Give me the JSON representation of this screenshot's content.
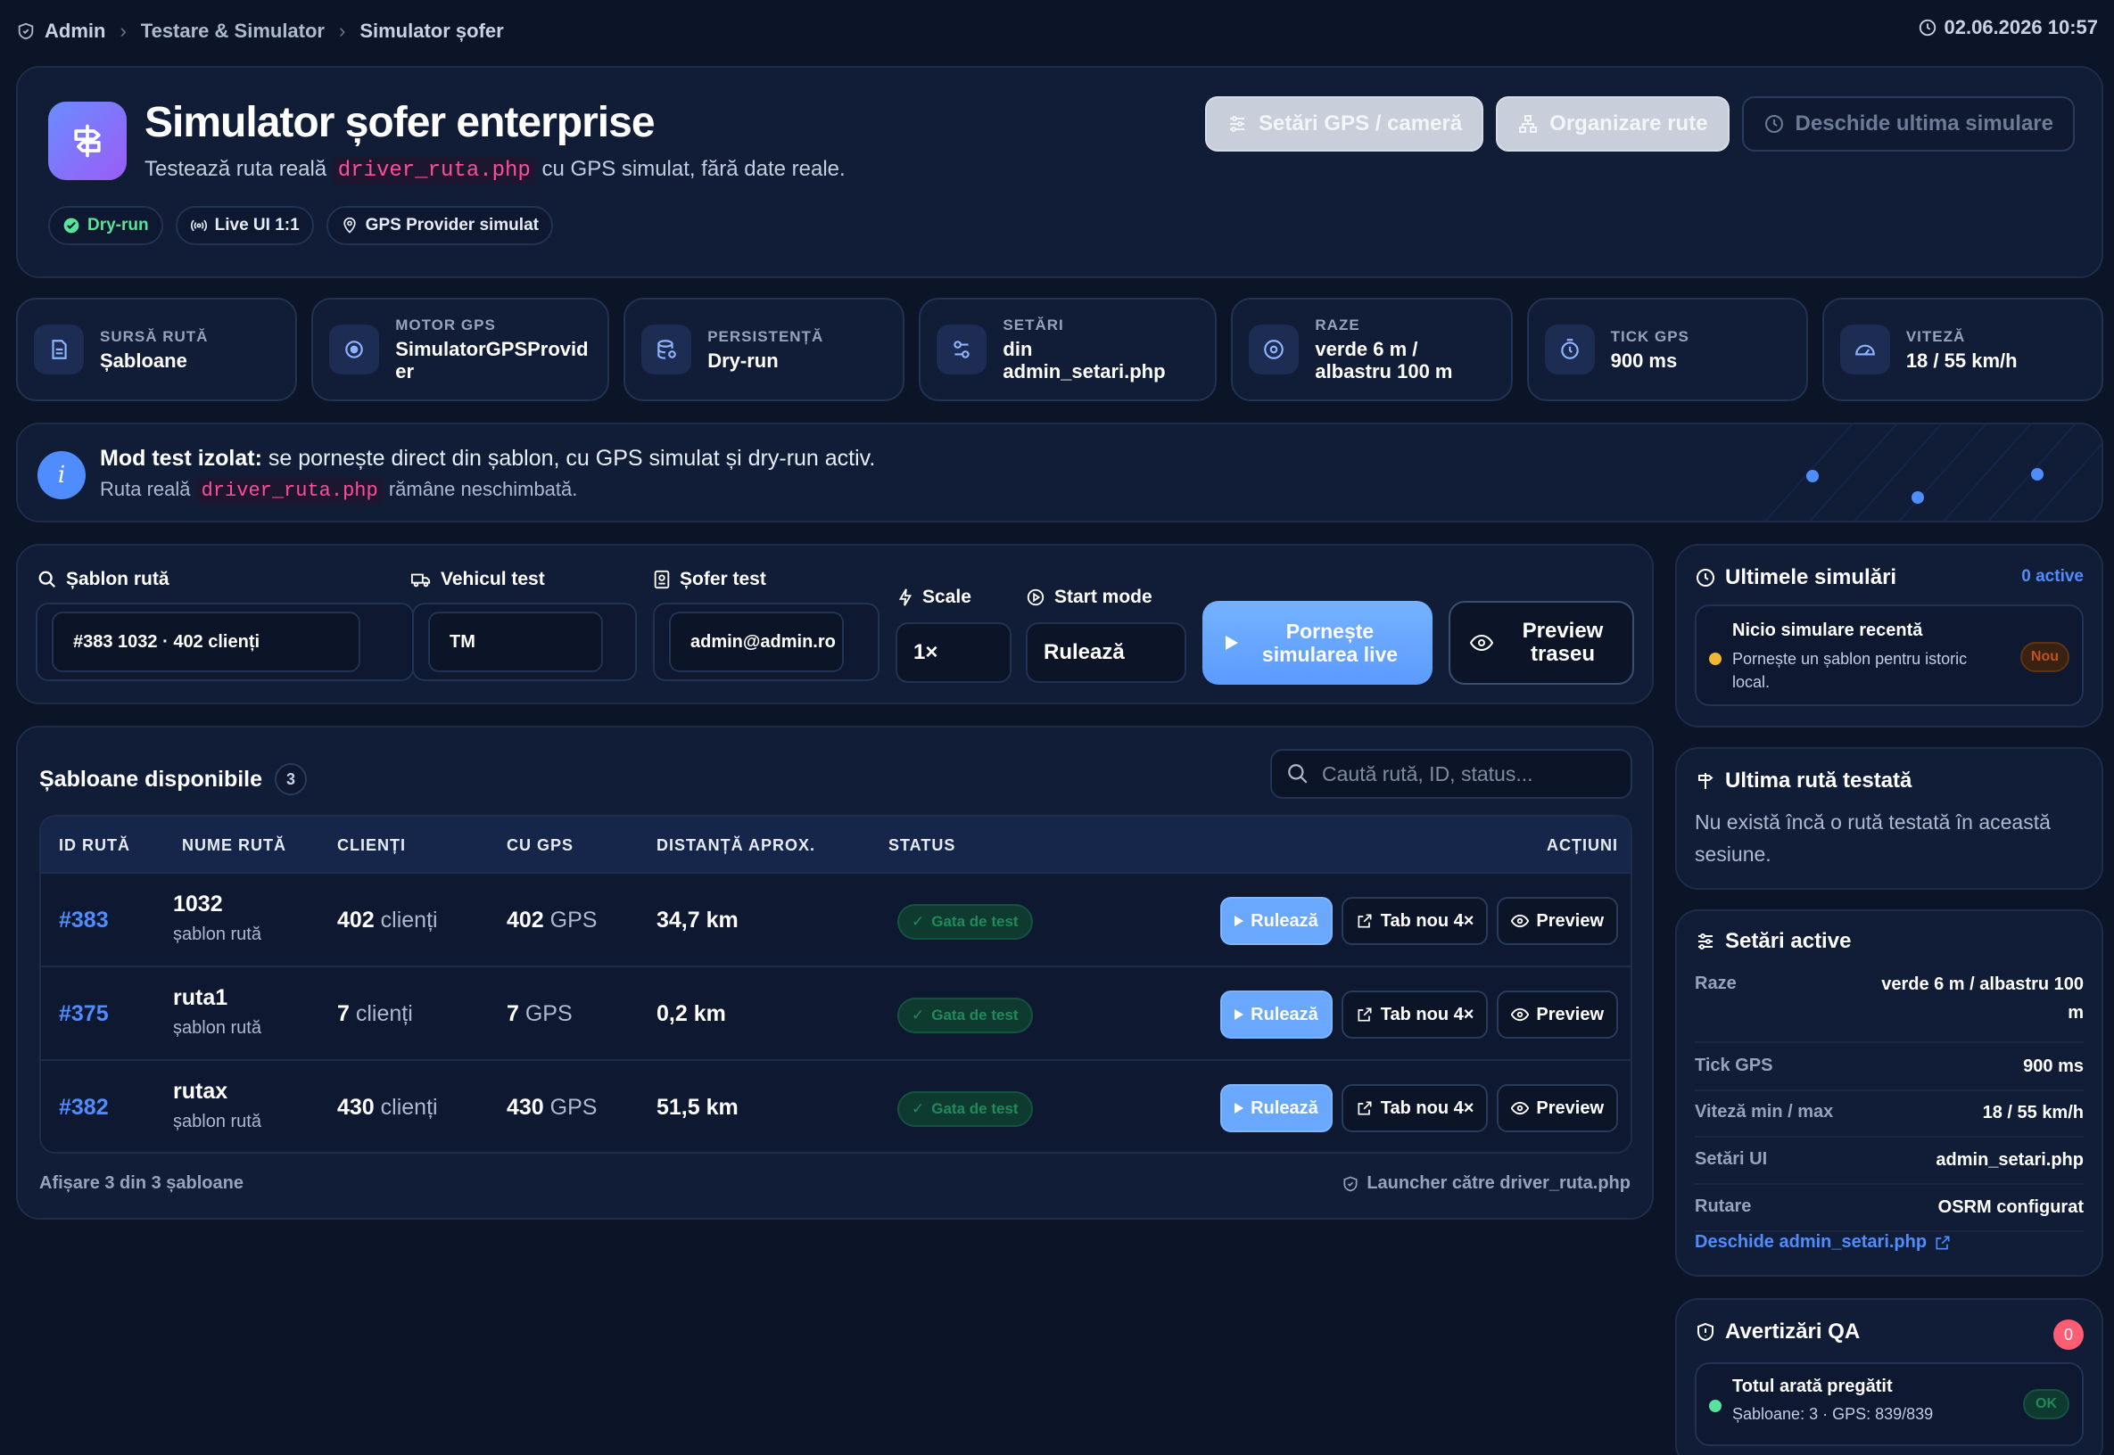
{
  "breadcrumb": [
    "Admin",
    "Testare & Simulator",
    "Simulator șofer"
  ],
  "datetime": "02.06.2026 10:57",
  "hero": {
    "title": "Simulator șofer enterprise",
    "subtitle_before": "Testează ruta reală",
    "subtitle_code": "driver_ruta.php",
    "subtitle_after": "cu GPS simulat, fără date reale.",
    "chips": [
      "Dry-run",
      "Live UI 1:1",
      "GPS Provider simulat"
    ],
    "buttons": {
      "gps": "Setări GPS / cameră",
      "routes": "Organizare rute",
      "last": "Deschide ultima simulare"
    }
  },
  "stats": [
    {
      "label": "SURSĂ RUTĂ",
      "value": "Șabloane",
      "icon": "document-icon"
    },
    {
      "label": "MOTOR GPS",
      "value": "SimulatorGPSProvider",
      "icon": "gps-target-icon"
    },
    {
      "label": "PERSISTENȚĂ",
      "value": "Dry-run",
      "icon": "database-icon"
    },
    {
      "label": "SETĂRI",
      "value": "din admin_setari.php",
      "icon": "settings-icon"
    },
    {
      "label": "RAZE",
      "value": "verde 6 m / albastru 100 m",
      "icon": "radius-icon"
    },
    {
      "label": "TICK GPS",
      "value": "900 ms",
      "icon": "timer-icon"
    },
    {
      "label": "VITEZĂ",
      "value": "18 / 55 km/h",
      "icon": "speedometer-icon"
    }
  ],
  "info": {
    "bold": "Mod test izolat:",
    "text": "se pornește direct din șablon, cu GPS simulat și dry-run activ.",
    "l2_before": "Ruta reală",
    "l2_code": "driver_ruta.php",
    "l2_after": "rămâne neschimbată."
  },
  "form": {
    "route_label": "Șablon rută",
    "route_value": "#383 1032 · 402 clienți",
    "vehicle_label": "Vehicul test",
    "vehicle_value": "TM",
    "driver_label": "Șofer test",
    "driver_value": "admin@admin.ro",
    "scale_label": "Scale",
    "scale_value": "1×",
    "start_label": "Start mode",
    "start_value": "Rulează",
    "start_button": "Pornește simularea live",
    "preview_button": "Preview traseu"
  },
  "templates": {
    "title": "Șabloane disponibile",
    "count": "3",
    "search_placeholder": "Caută rută, ID, status...",
    "headers": [
      "ID RUTĂ",
      "NUME RUTĂ",
      "CLIENȚI",
      "CU GPS",
      "DISTANȚĂ APROX.",
      "STATUS",
      "ACȚIUNI"
    ],
    "rows": [
      {
        "id": "#383",
        "name": "1032",
        "sub": "șablon rută",
        "clients_n": "402",
        "clients_w": "clienți",
        "gps_n": "402",
        "gps_w": "GPS",
        "dist": "34,7 km",
        "status": "Gata de test"
      },
      {
        "id": "#375",
        "name": "ruta1",
        "sub": "șablon rută",
        "clients_n": "7",
        "clients_w": "clienți",
        "gps_n": "7",
        "gps_w": "GPS",
        "dist": "0,2 km",
        "status": "Gata de test"
      },
      {
        "id": "#382",
        "name": "rutax",
        "sub": "șablon rută",
        "clients_n": "430",
        "clients_w": "clienți",
        "gps_n": "430",
        "gps_w": "GPS",
        "dist": "51,5 km",
        "status": "Gata de test"
      }
    ],
    "actions": {
      "run": "Rulează",
      "tab": "Tab nou 4×",
      "preview": "Preview"
    },
    "footer_left": "Afișare 3 din 3 șabloane",
    "footer_right": "Launcher către driver_ruta.php"
  },
  "recent": {
    "title": "Ultimele simulări",
    "active": "0 active",
    "item_title": "Nicio simulare recentă",
    "item_text": "Pornește un șablon pentru istoric local.",
    "item_badge": "Nou"
  },
  "last_route": {
    "title": "Ultima rută testată",
    "text": "Nu există încă o rută testată în această sesiune."
  },
  "settings": {
    "title": "Setări active",
    "items": [
      {
        "k": "Raze",
        "v": "verde 6 m / albastru 100 m"
      },
      {
        "k": "Tick GPS",
        "v": "900 ms"
      },
      {
        "k": "Viteză min / max",
        "v": "18 / 55 km/h"
      },
      {
        "k": "Setări UI",
        "v": "admin_setari.php"
      },
      {
        "k": "Rutare",
        "v": "OSRM configurat"
      }
    ],
    "link": "Deschide admin_setari.php"
  },
  "qa": {
    "title": "Avertizări QA",
    "count": "0",
    "item_title": "Totul arată pregătit",
    "item_text": "Șabloane: 3 · GPS: 839/839",
    "item_badge": "OK"
  },
  "colors": {
    "background": "#0c1528",
    "card": "#111d36",
    "accent": "#4f8dff",
    "success": "#58e39c",
    "code": "#ff4d9a",
    "warning": "#f2b632",
    "danger": "#ff5d73"
  }
}
